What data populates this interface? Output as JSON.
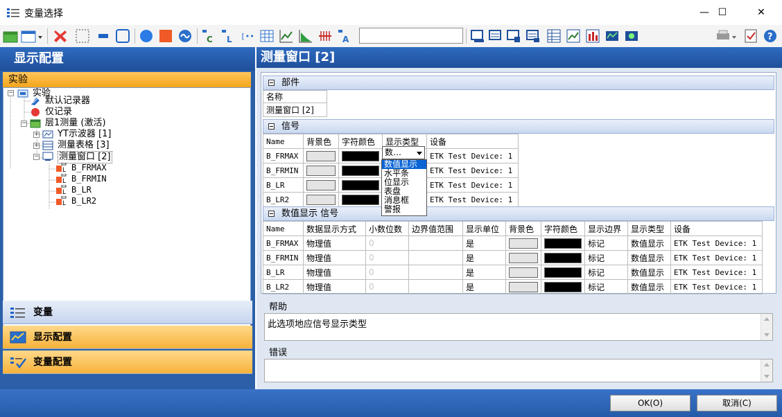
{
  "window": {
    "title": "变量选择",
    "minimize": "—",
    "maximize": "☐",
    "close": "✕"
  },
  "toolbar": {
    "icons": [
      "add-window-icon",
      "window-dropdown-icon",
      "delete-icon",
      "select-rect-icon",
      "bar-icon",
      "rounded-rect-icon",
      "blue-circle-icon",
      "red-square-icon",
      "signal-circle-icon",
      "signal-c-icon",
      "signal-l-icon",
      "bracket-icon",
      "table-icon",
      "line-chart-icon",
      "area-chart-icon",
      "bars-icon",
      "signal-a-icon"
    ],
    "search_value": ""
  },
  "left": {
    "header": "显示配置",
    "section": "实验",
    "tree": [
      {
        "label": "实验",
        "icon": "experiment-icon"
      },
      {
        "label": "默认记录器",
        "icon": "recorder-icon"
      },
      {
        "label": "仅记录",
        "icon": "record-only-icon"
      },
      {
        "label": "层1测量 (激活)",
        "icon": "layer-icon"
      },
      {
        "label": "YT示波器 [1]",
        "icon": "oscilloscope-icon"
      },
      {
        "label": "测量表格 [3]",
        "icon": "table-window-icon"
      },
      {
        "label": "测量窗口 [2]",
        "icon": "measure-window-icon"
      },
      {
        "label": "B_FRMAX",
        "icon": "signal-icon"
      },
      {
        "label": "B_FRMIN",
        "icon": "signal-icon"
      },
      {
        "label": "B_LR",
        "icon": "signal-icon"
      },
      {
        "label": "B_LR2",
        "icon": "signal-icon"
      }
    ],
    "nav": [
      {
        "label": "变量",
        "icon": "variables-icon"
      },
      {
        "label": "显示配置",
        "icon": "display-config-icon"
      },
      {
        "label": "变量配置",
        "icon": "variable-config-icon"
      }
    ]
  },
  "right": {
    "header": "测量窗口 [2]",
    "components": {
      "title": "部件",
      "col": "名称",
      "value": "测量窗口 [2]"
    },
    "signals": {
      "title": "信号",
      "columns": [
        "Name",
        "背景色",
        "字符颜色",
        "显示类型",
        "设备"
      ],
      "rows": [
        {
          "name": "B_FRMAX",
          "type": "数…",
          "device": "ETK Test Device: 1"
        },
        {
          "name": "B_FRMIN",
          "type": "",
          "device": "ETK Test Device: 1"
        },
        {
          "name": "B_LR",
          "type": "",
          "device": "ETK Test Device: 1"
        },
        {
          "name": "B_LR2",
          "type": "",
          "device": "ETK Test Device: 1"
        }
      ]
    },
    "dropdown_options": [
      "数值显示",
      "水平条",
      "位显示",
      "表盘",
      "消息框",
      "警报"
    ],
    "numeric": {
      "title": "数值显示 信号",
      "columns": [
        "Name",
        "数据显示方式",
        "小数位数",
        "边界值范围",
        "显示单位",
        "背景色",
        "字符颜色",
        "显示边界",
        "显示类型",
        "设备"
      ],
      "rows": [
        {
          "name": "B_FRMAX",
          "mode": "物理值",
          "decimals": "0",
          "unit": "是",
          "bound": "标记",
          "type": "数值显示",
          "device": "ETK Test Device: 1"
        },
        {
          "name": "B_FRMIN",
          "mode": "物理值",
          "decimals": "0",
          "unit": "是",
          "bound": "标记",
          "type": "数值显示",
          "device": "ETK Test Device: 1"
        },
        {
          "name": "B_LR",
          "mode": "物理值",
          "decimals": "0",
          "unit": "是",
          "bound": "标记",
          "type": "数值显示",
          "device": "ETK Test Device: 1"
        },
        {
          "name": "B_LR2",
          "mode": "物理值",
          "decimals": "0",
          "unit": "是",
          "bound": "标记",
          "type": "数值显示",
          "device": "ETK Test Device: 1"
        }
      ]
    },
    "help": {
      "label": "帮助",
      "text": "此选项地应信号显示类型"
    },
    "error": {
      "label": "错误",
      "text": ""
    }
  },
  "buttons": {
    "ok": "OK(O)",
    "cancel": "取消(C)"
  },
  "colors": {
    "accent_blue": "#2b5fa8",
    "orange": "#f3a51c",
    "selection": "#0a64d6"
  }
}
